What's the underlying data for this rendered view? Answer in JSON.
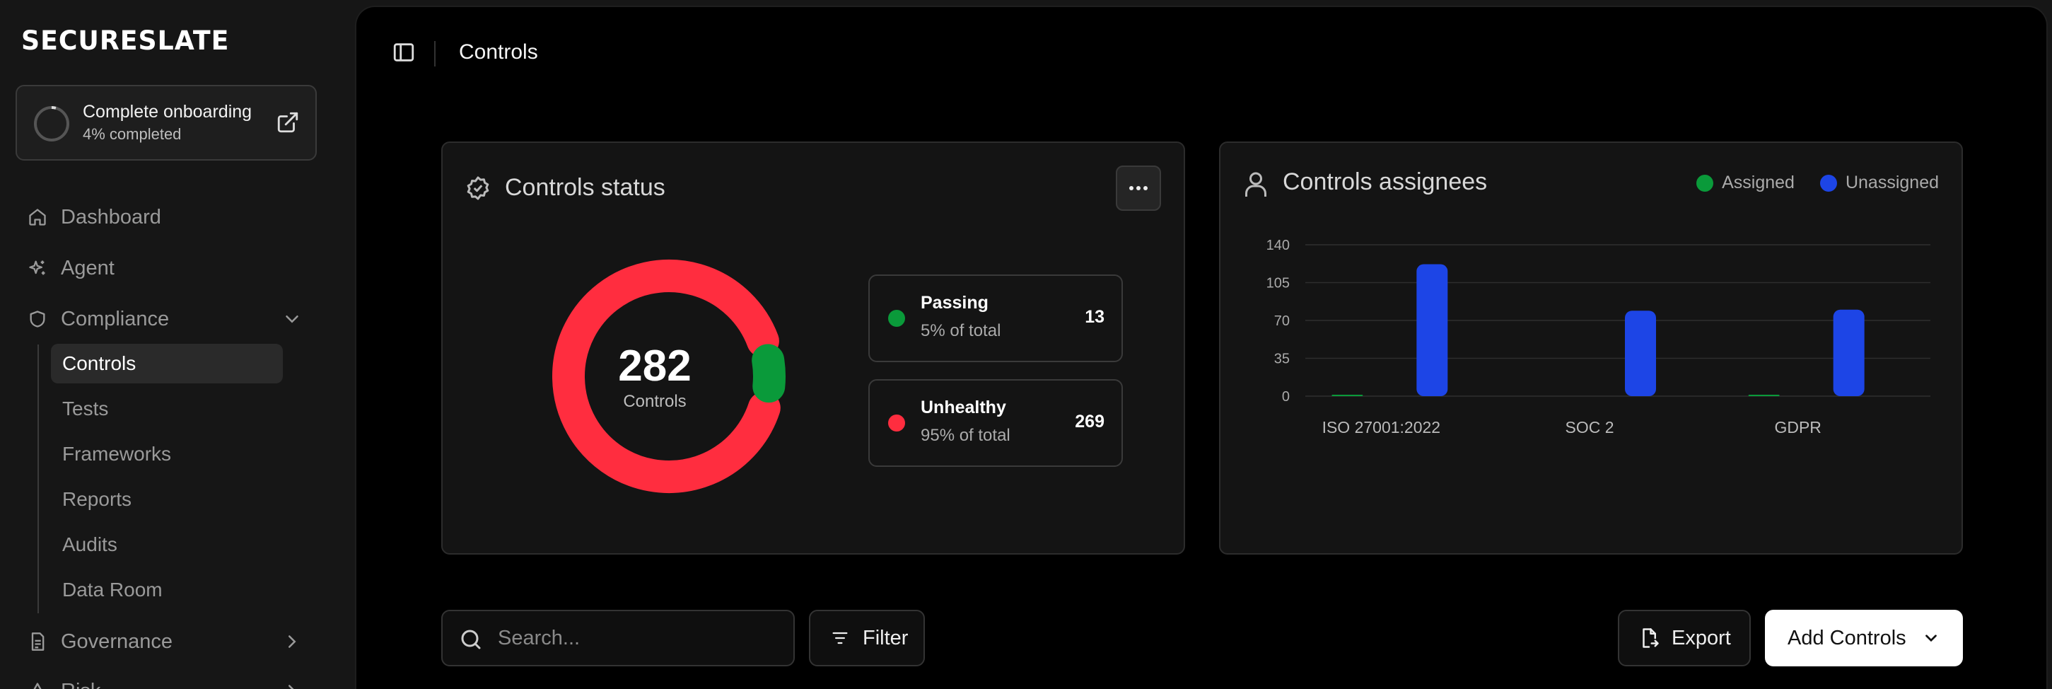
{
  "app": {
    "brand": "SECURESLATE"
  },
  "onboarding": {
    "title": "Complete onboarding",
    "progress_text": "4% completed",
    "progress": 0.04
  },
  "sidebar": {
    "items": [
      {
        "label": "Dashboard",
        "icon": "home-icon"
      },
      {
        "label": "Agent",
        "icon": "sparkles-icon"
      },
      {
        "label": "Compliance",
        "icon": "shield-icon",
        "expanded": true
      },
      {
        "label": "Governance",
        "icon": "document-icon"
      },
      {
        "label": "Risk",
        "icon": "warning-icon"
      }
    ],
    "compliance_children": [
      "Controls",
      "Tests",
      "Frameworks",
      "Reports",
      "Audits",
      "Data Room"
    ],
    "active": "Controls"
  },
  "header": {
    "title": "Controls"
  },
  "status_card": {
    "title": "Controls status",
    "total": "282",
    "total_label": "Controls",
    "passing": {
      "label": "Passing",
      "pct": "5% of total",
      "value": "13",
      "color": "#0a9a3a"
    },
    "unhealthy": {
      "label": "Unhealthy",
      "pct": "95% of total",
      "value": "269",
      "color": "#ff2d3f"
    }
  },
  "assignees_card": {
    "title": "Controls assignees",
    "legend": [
      {
        "label": "Assigned",
        "color": "#0a9a3a"
      },
      {
        "label": "Unassigned",
        "color": "#1d45e6"
      }
    ]
  },
  "chart_data": {
    "type": "bar",
    "categories": [
      "ISO 27001:2022",
      "SOC 2",
      "GDPR"
    ],
    "series": [
      {
        "name": "Assigned",
        "values": [
          1,
          0,
          1
        ],
        "color": "#0a9a3a"
      },
      {
        "name": "Unassigned",
        "values": [
          122,
          79,
          80
        ],
        "color": "#1d45e6"
      }
    ],
    "yticks": [
      0,
      35,
      70,
      105,
      140
    ],
    "ylim": [
      0,
      140
    ],
    "grid": true
  },
  "toolbar": {
    "search_placeholder": "Search...",
    "filter_label": "Filter",
    "export_label": "Export",
    "add_label": "Add Controls"
  }
}
